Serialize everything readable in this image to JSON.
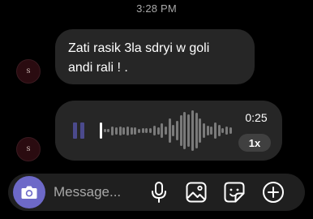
{
  "status": {
    "timestamp": "3:28 PM"
  },
  "contact": {
    "avatar_letter": "S"
  },
  "messages": [
    {
      "type": "text",
      "lines": [
        "Zati rasik 3la sdryi w goli",
        "andi rali ! ."
      ]
    },
    {
      "type": "voice",
      "duration": "0:25",
      "speed": "1x",
      "state": "paused",
      "progress_fraction": 0.02
    }
  ],
  "composer": {
    "placeholder": "Message..."
  },
  "icons": {
    "camera": "camera-icon",
    "pause": "pause-icon",
    "mic": "microphone-icon",
    "gallery": "gallery-icon",
    "sticker": "sticker-icon",
    "plus": "plus-circle-icon"
  },
  "colors": {
    "background": "#000000",
    "bubble": "#262626",
    "accent": "#6d69c8",
    "pause": "#4b4a8c",
    "wave_unplayed": "#7a7a7a",
    "wave_played": "#ffffff",
    "secondary_text": "#a8a8a8"
  }
}
